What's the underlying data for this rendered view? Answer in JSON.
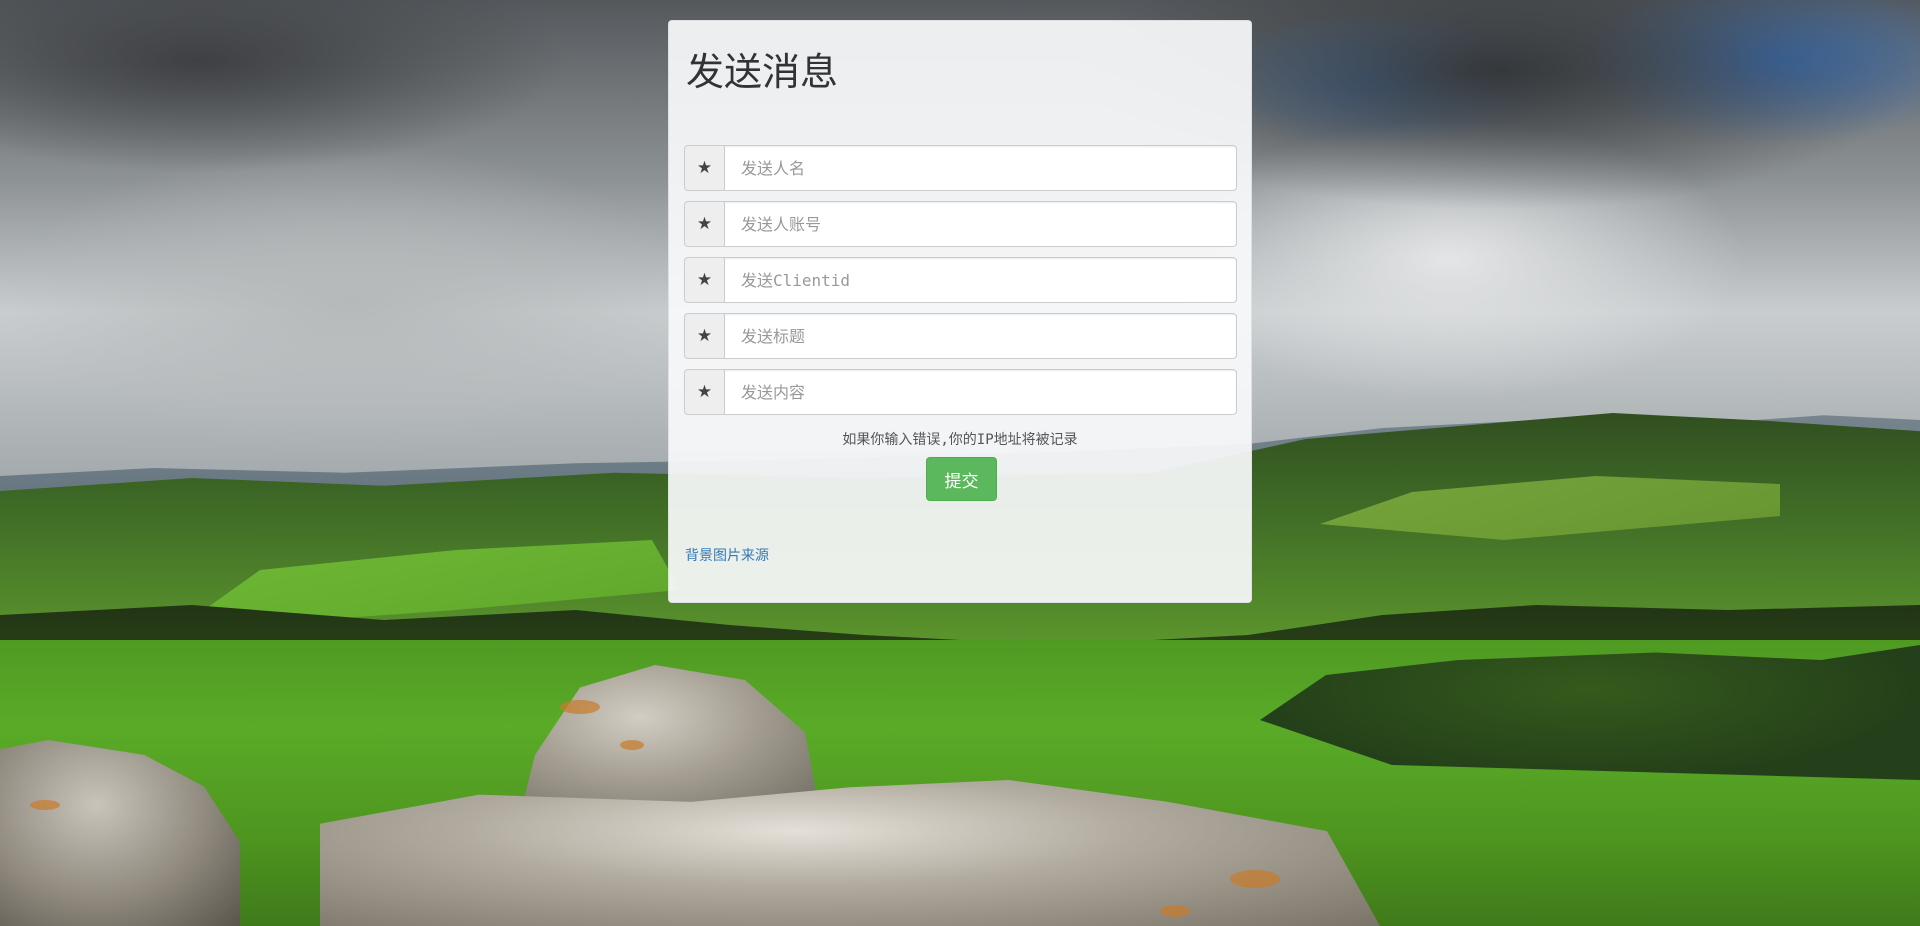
{
  "form": {
    "title": "发送消息",
    "required_icon": "star-icon",
    "required_glyph": "★",
    "fields": [
      {
        "placeholder": "发送人名",
        "value": ""
      },
      {
        "placeholder": "发送人账号",
        "value": ""
      },
      {
        "placeholder": "发送Clientid",
        "value": ""
      },
      {
        "placeholder": "发送标题",
        "value": ""
      },
      {
        "placeholder": "发送内容",
        "value": ""
      }
    ],
    "warning": "如果你输入错误,你的IP地址将被记录",
    "submit_label": "提交",
    "background_source_label": "背景图片来源"
  },
  "colors": {
    "submit_button": "#5cb85c",
    "link": "#337ab7",
    "panel": "#f8f9fa"
  }
}
